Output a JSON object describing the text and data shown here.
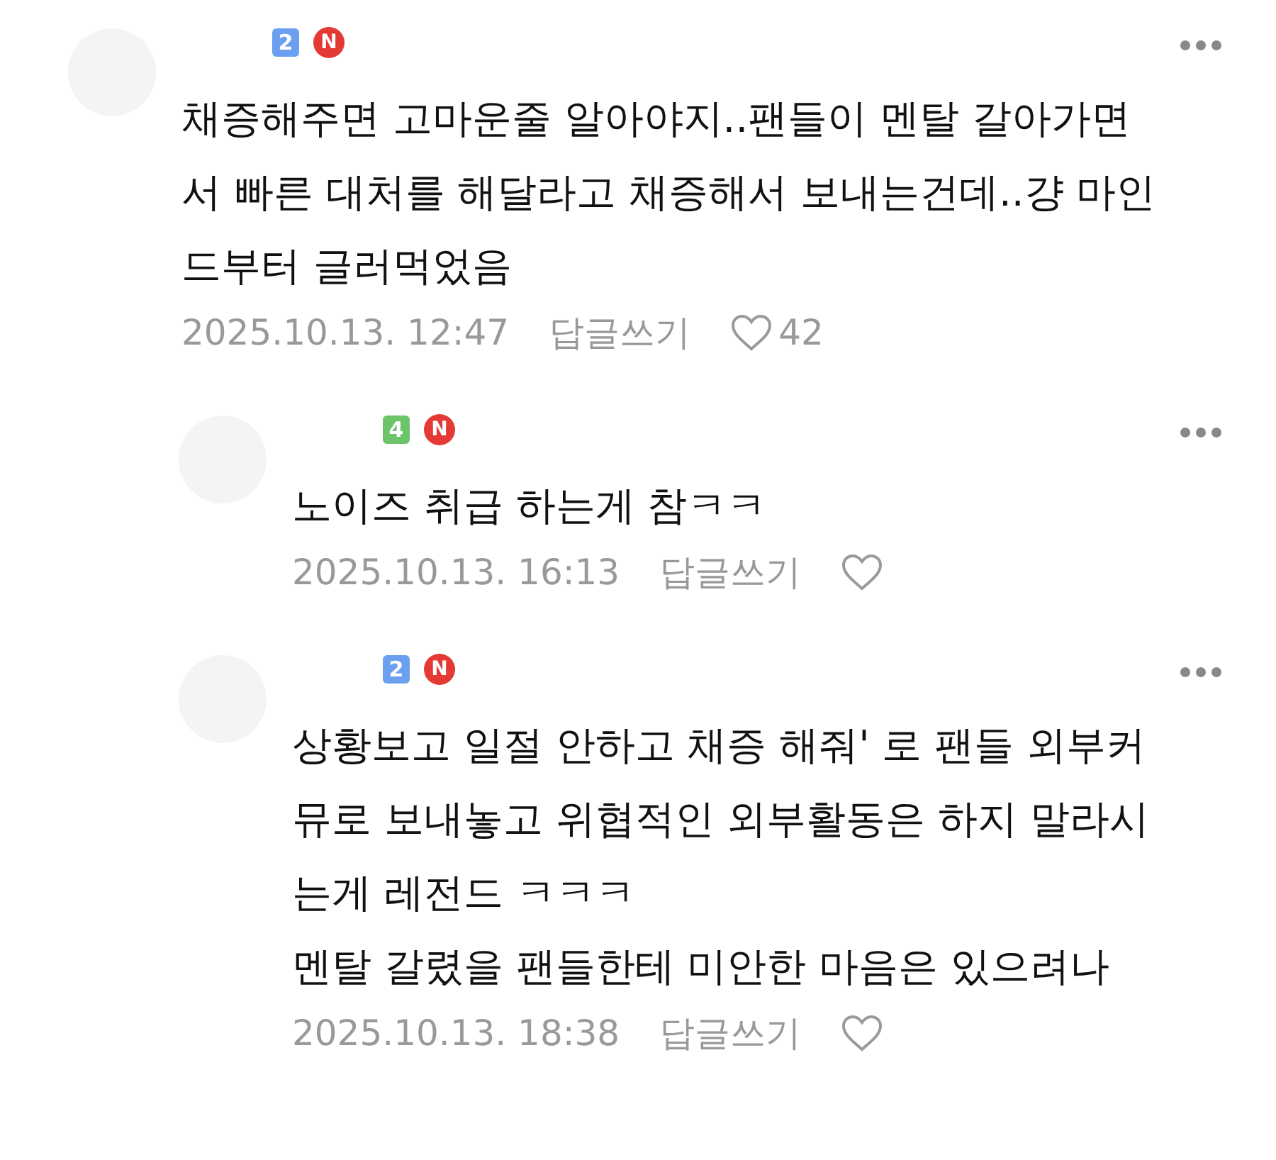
{
  "comments": [
    {
      "level_badge": {
        "text": "2",
        "color": "#6b9ff0"
      },
      "new_badge": "N",
      "text": "채증해주면 고마운줄 알아야지..팬들이 멘탈 갈아가면\n서 빠른 대처를 해달라고 채증해서 보내는건데..걍 마인\n드부터 글러먹었음",
      "date": "2025.10.13. 12:47",
      "reply_link": "답글쓰기",
      "like_count": "42",
      "children": [
        {
          "level_badge": {
            "text": "4",
            "color": "#6cc36a"
          },
          "new_badge": "N",
          "text": "노이즈 취급 하는게 참ㅋㅋ",
          "date": "2025.10.13. 16:13",
          "reply_link": "답글쓰기"
        },
        {
          "level_badge": {
            "text": "2",
            "color": "#6b9ff0"
          },
          "new_badge": "N",
          "text": "상황보고 일절 안하고 채증 해줘' 로 팬들 외부커\n뮤로 보내놓고 위협적인 외부활동은 하지 말라시\n는게 레전드 ㅋㅋㅋ\n멘탈 갈렸을 팬들한테 미안한 마음은 있으려나",
          "date": "2025.10.13. 18:38",
          "reply_link": "답글쓰기"
        }
      ]
    }
  ]
}
